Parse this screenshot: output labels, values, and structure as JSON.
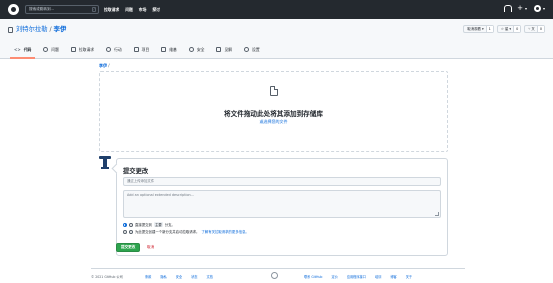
{
  "topbar": {
    "search_placeholder": "搜索或跳转到...",
    "search_shortcut": "/",
    "nav": [
      "拉取请求",
      "问题",
      "市场",
      "探讨"
    ],
    "plus": "+",
    "caret": "▾"
  },
  "repo": {
    "owner": "刘特尔拉勒",
    "separator": "/",
    "name": "李伊",
    "actions": [
      {
        "label": "取消观看 ▾",
        "count": "1"
      },
      {
        "label": "☆ 星 ▾",
        "count": "0"
      },
      {
        "label": "⑂ 叉",
        "count": "0"
      }
    ],
    "tabs": [
      {
        "label": "代码",
        "icon": "code-icon"
      },
      {
        "label": "问题",
        "icon": "issue-icon"
      },
      {
        "label": "拉取请求",
        "icon": "pull-request-icon"
      },
      {
        "label": "行动",
        "icon": "actions-icon"
      },
      {
        "label": "项目",
        "icon": "project-icon"
      },
      {
        "label": "维基",
        "icon": "wiki-icon"
      },
      {
        "label": "安全",
        "icon": "security-icon"
      },
      {
        "label": "见解",
        "icon": "insights-icon"
      },
      {
        "label": "设置",
        "icon": "settings-icon"
      }
    ]
  },
  "main": {
    "breadcrumb": "李伊",
    "breadcrumb_sep": "/",
    "drop_title": "将文件拖动此处将其添加到存储库",
    "drop_sub": "或选择您的文件",
    "commit": {
      "title": "提交更改",
      "summary_placeholder": "通过上传添加文件",
      "description_placeholder": "Add an optional extended description...",
      "option1_prefix": "直接提交到",
      "option1_branch": "主要",
      "option1_suffix": "分支。",
      "option2_text": "为此提交创建一个新分支并启动拉取请求。",
      "option2_link": "了解有关拉取请求的更多信息。",
      "commit_button": "提交更改",
      "cancel_button": "取消"
    }
  },
  "footer": {
    "copyright": "© 2021 GitHub 公司",
    "links_left": [
      "条款",
      "隐私",
      "安全",
      "状态",
      "文档"
    ],
    "links_right": [
      "联系 GitHub",
      "定价",
      "应用程序接口",
      "培训",
      "博客",
      "关于"
    ]
  },
  "colors": {
    "header_bg": "#24292f",
    "link": "#0969da",
    "primary_button": "#2da44e",
    "danger": "#cf222e",
    "active_tab_underline": "#fd8c73"
  }
}
